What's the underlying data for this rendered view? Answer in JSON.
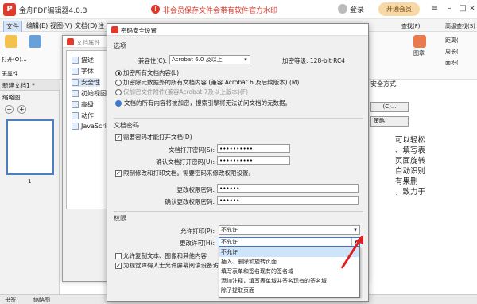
{
  "app": {
    "title": "金舟PDF编辑器4.0.3",
    "promo": "非会员保存文件会带有软件官方水印",
    "login": "登录",
    "vip": "开通会员"
  },
  "menu": [
    "文件",
    "编辑(E)",
    "视图(V)",
    "文档(D)",
    "注"
  ],
  "toolbar": {
    "open": "打开(O)...",
    "none_label": "无属性",
    "search": "查找(F)",
    "advsearch": "高级查找(S)",
    "chapter": "章",
    "doc_chapter": "图章",
    "distance": "距离(",
    "perimeter": "周长(",
    "area": "面积("
  },
  "tabs": {
    "newdoc": "新建文档1 *",
    "thumbnails": "缩略图",
    "bookmarks": "书签",
    "thumbnail_tab": "缩略图"
  },
  "page_number": "1",
  "right_doc_text": [
    "可以轻松",
    "、填写表",
    "页面旋转",
    "自动识别",
    "有果删",
    "，致力于"
  ],
  "right_buttons": {
    "r1": "安全方式.",
    "r2": "(C)...",
    "r3": "策略"
  },
  "props_dialog": {
    "title": "文档属性",
    "tree": [
      "描述",
      "字体",
      "安全性",
      "初始视图",
      "高级",
      "动作",
      "JavaScript"
    ]
  },
  "sec_dialog": {
    "title": "密码安全设置",
    "options_label": "选项",
    "compat_label": "兼容性(C):",
    "compat_value": "Acrobat 6.0 及以上",
    "enc_level": "加密等级: 128-bit RC4",
    "radio1": "加密所有文档内容(L)",
    "radio2": "加密除元数据外的所有文档内容 (兼容 Acrobat 6 及后续版本) (M)",
    "radio3": "仅加密文件附件(兼容Acrobat 7及以上版本)(F)",
    "info": "文档的所有内容将被加密，搜索引擎将无法访问文档的元数据。",
    "docpw_label": "文档密码",
    "require_pw": "需要密码才能打开文档(D)",
    "open_pw_label": "文档打开密码(S):",
    "open_pw": "••••••••••",
    "confirm_open_label": "确认文档打开密码(U):",
    "confirm_open_pw": "••••••••••",
    "restrict": "限制修改和打印文档。需要密码来修改权限设置。",
    "change_pw_label": "更改权限密码:",
    "change_pw": "••••••",
    "confirm_change_label": "确认更改权限密码:",
    "confirm_change_pw": "••••••",
    "perm_label": "权限",
    "print_label": "允许打印(P):",
    "print_value": "不允许",
    "change_label": "更改许可(H):",
    "change_value": "不允许",
    "copy": "允许复制文本、图像和其他内容",
    "reader": "为视觉障碍人士允许屏幕阅读设备访问文"
  },
  "dropdown_options": [
    "不允许",
    "插入、删除和旋转页面",
    "填写表单和签名现有的签名域",
    "添加注释，填写表单域并签名现有的签名域",
    "除了提取页面"
  ],
  "colors": {
    "brand": "#e03a2e",
    "arrow": "#e02020",
    "highlight": "#cde4fa"
  }
}
